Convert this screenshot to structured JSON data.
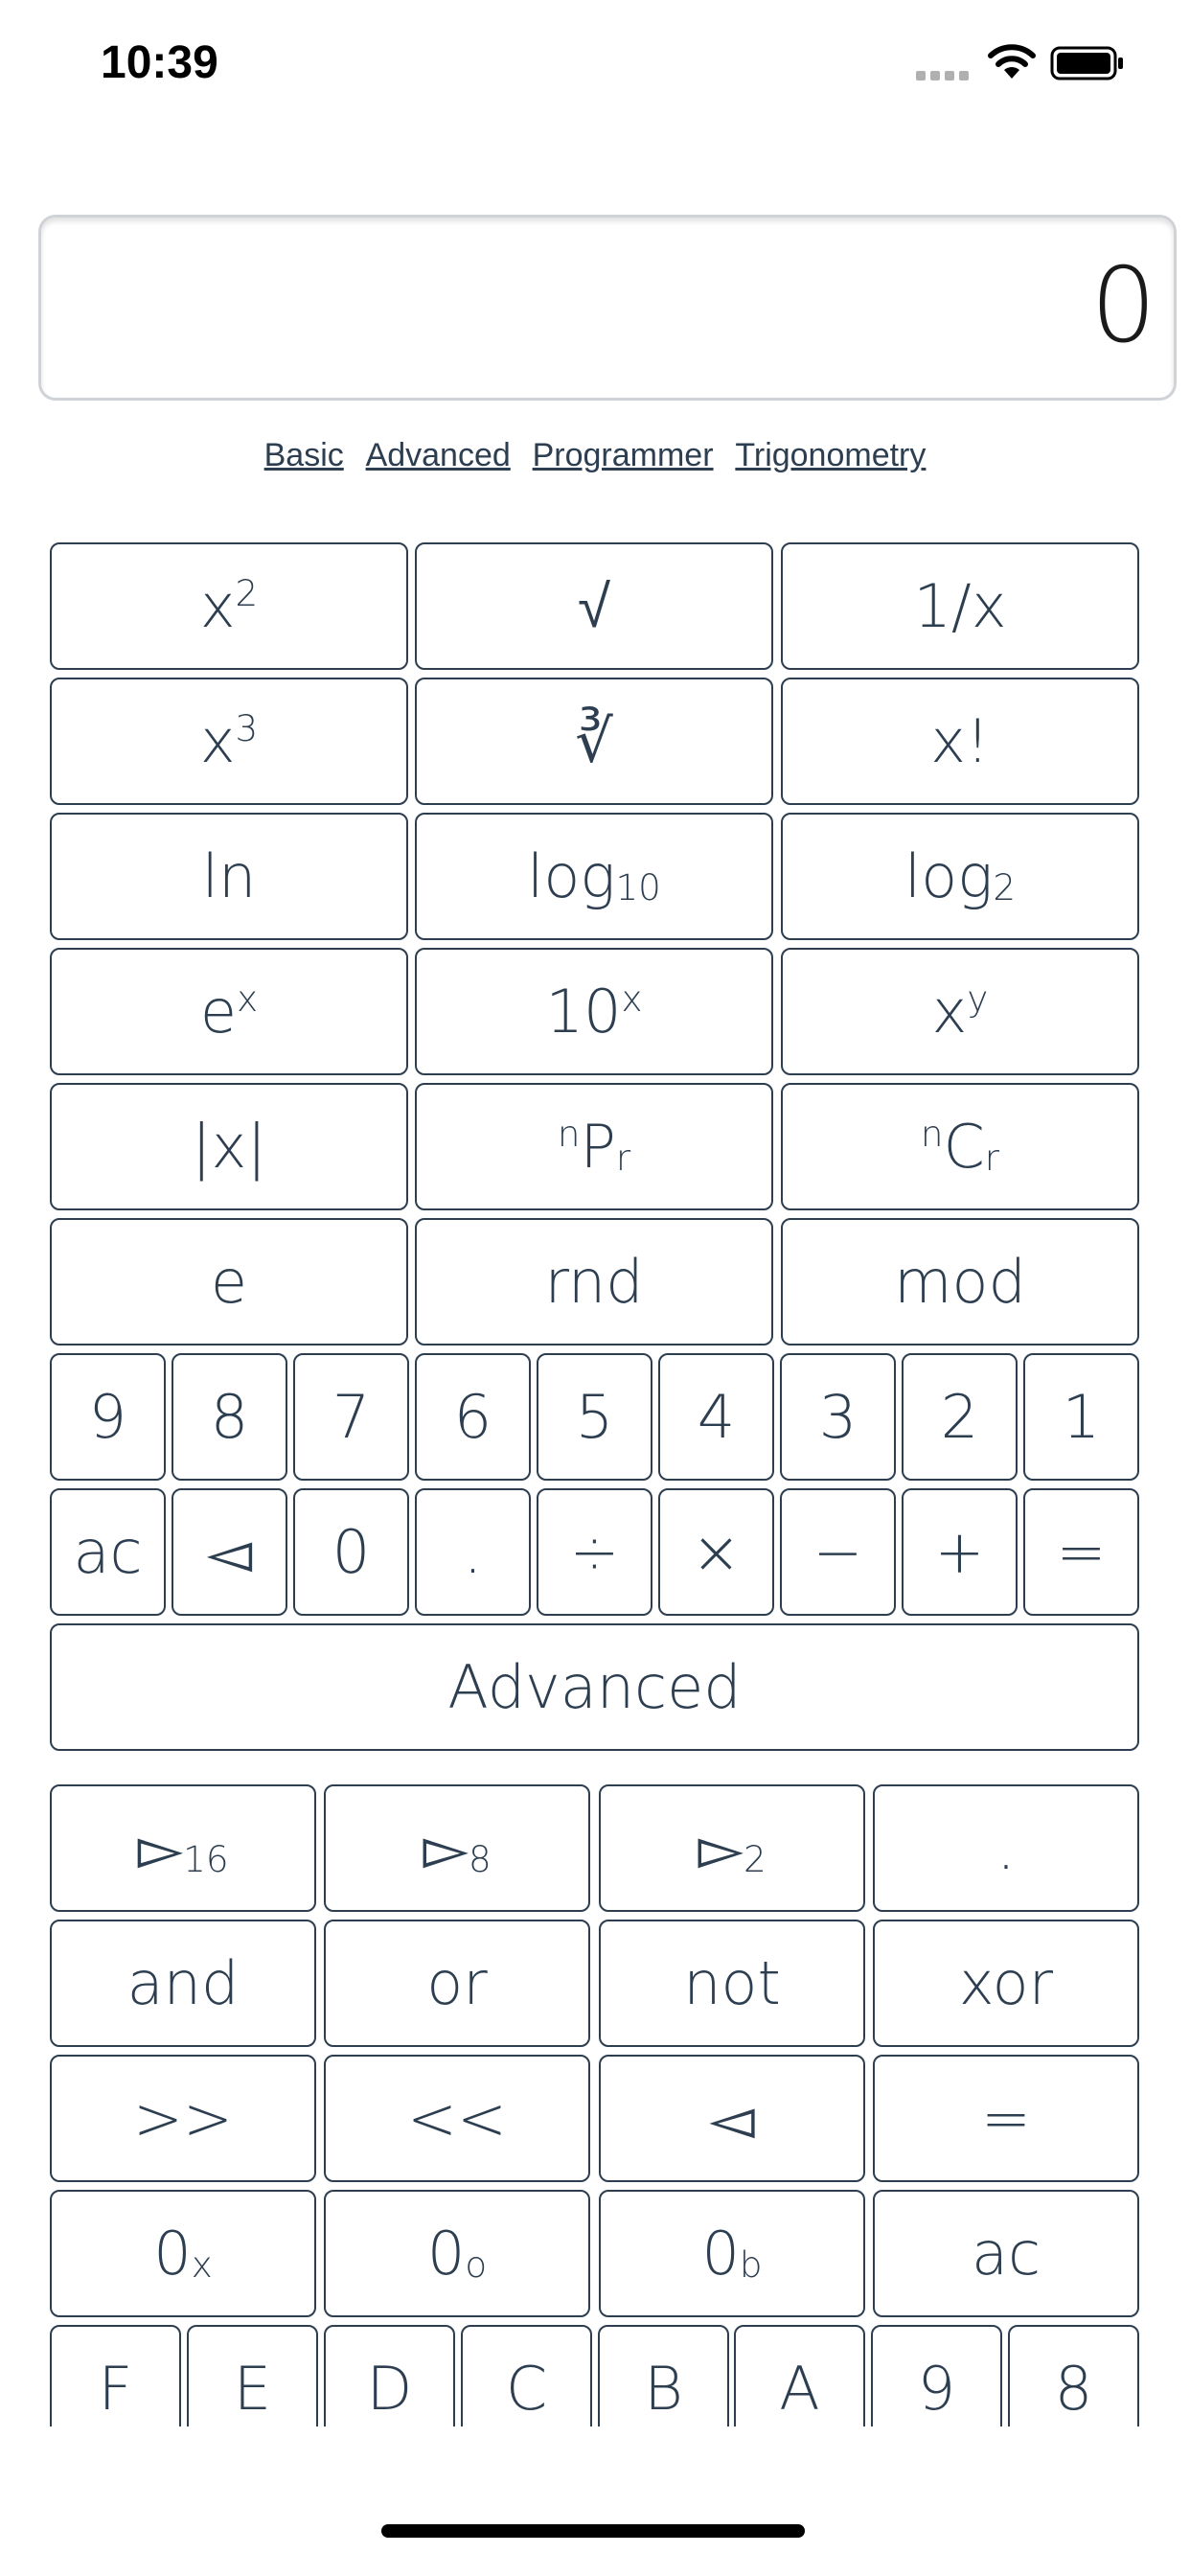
{
  "status": {
    "time": "10:39"
  },
  "display": {
    "value": "0"
  },
  "modes": [
    "Basic",
    "Advanced",
    "Programmer",
    "Trigonometry"
  ],
  "scientific": {
    "rows": [
      [
        {
          "base": "x",
          "sup": "2"
        },
        {
          "base": "√"
        },
        {
          "base": "1/x"
        }
      ],
      [
        {
          "base": "x",
          "sup": "3"
        },
        {
          "base": "∛"
        },
        {
          "base": "x!"
        }
      ],
      [
        {
          "base": "ln"
        },
        {
          "base": "log",
          "sub": "10"
        },
        {
          "base": "log",
          "sub": "2"
        }
      ],
      [
        {
          "base": "e",
          "sup": "x"
        },
        {
          "base": "10",
          "sup": "x"
        },
        {
          "base": "x",
          "sup": "y"
        }
      ],
      [
        {
          "base": "|x|"
        },
        {
          "pre": "n",
          "base": "P",
          "sub": "r"
        },
        {
          "pre": "n",
          "base": "C",
          "sub": "r"
        }
      ],
      [
        {
          "base": "e"
        },
        {
          "base": "rnd"
        },
        {
          "base": "mod"
        }
      ]
    ]
  },
  "digits": [
    "9",
    "8",
    "7",
    "6",
    "5",
    "4",
    "3",
    "2",
    "1"
  ],
  "operators": [
    "ac",
    "◅",
    "0",
    ".",
    "÷",
    "×",
    "−",
    "+",
    "="
  ],
  "advanced_toggle": "Advanced",
  "programmer": {
    "rows": [
      [
        {
          "base": "▻",
          "sub": "16"
        },
        {
          "base": "▻",
          "sub": "8"
        },
        {
          "base": "▻",
          "sub": "2"
        },
        {
          "base": "."
        }
      ],
      [
        {
          "base": "and"
        },
        {
          "base": "or"
        },
        {
          "base": "not"
        },
        {
          "base": "xor"
        }
      ],
      [
        {
          "base": ">>"
        },
        {
          "base": "<<"
        },
        {
          "base": "◅"
        },
        {
          "base": "="
        }
      ],
      [
        {
          "base": "0",
          "sub": "x"
        },
        {
          "base": "0",
          "sub": "o"
        },
        {
          "base": "0",
          "sub": "b"
        },
        {
          "base": "ac"
        }
      ]
    ],
    "hex_digits": [
      "F",
      "E",
      "D",
      "C",
      "B",
      "A",
      "9",
      "8"
    ]
  }
}
